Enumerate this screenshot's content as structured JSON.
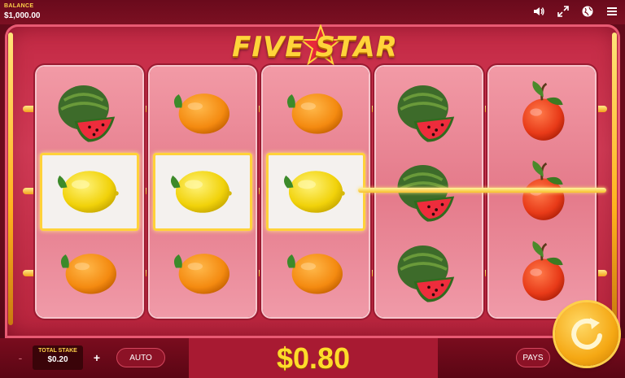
{
  "header": {
    "balance_label": "BALANCE",
    "balance_value": "$1,000.00",
    "icons": [
      "speaker-icon",
      "fullscreen-icon",
      "globe-icon",
      "menu-icon"
    ]
  },
  "game": {
    "title": "FIVE STAR",
    "reels": [
      [
        "watermelon",
        "lemon",
        "orange"
      ],
      [
        "orange",
        "lemon",
        "orange"
      ],
      [
        "orange",
        "lemon",
        "orange"
      ],
      [
        "watermelon",
        "watermelon",
        "watermelon"
      ],
      [
        "red-orange",
        "red-orange",
        "red-orange"
      ]
    ],
    "winning_cells": [
      [
        0,
        1
      ],
      [
        1,
        1
      ],
      [
        2,
        1
      ]
    ]
  },
  "controls": {
    "minus_label": "-",
    "stake_label": "TOTAL STAKE",
    "stake_value": "$0.20",
    "plus_label": "+",
    "auto_label": "AUTO",
    "win_amount": "$0.80",
    "pays_label": "PAYS"
  },
  "colors": {
    "accent_gold": "#ffd43a",
    "frame_red": "#c42a45",
    "win_text": "#ffdc2a"
  }
}
